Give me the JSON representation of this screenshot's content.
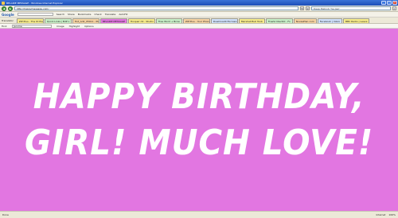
{
  "window": {
    "title": "BELAIRE MESSAGE - Windows Internet Explorer",
    "buttons": {
      "minimize": "_",
      "maximize": "□",
      "close": "×"
    }
  },
  "address_bar": {
    "url": "http://happymessage.com/",
    "search_placeholder": "Deep Mehndi \"Sa Jaa\""
  },
  "google_bar": {
    "logo": "Google",
    "items": [
      "Search",
      "Share",
      "Bookmarks",
      "Check",
      "Translate",
      "AutoFill"
    ]
  },
  "translator_bar": {
    "label": "Translator",
    "tabs": [
      {
        "label": "ZIP Plus - The ID Playing",
        "color": "#f7ec8a"
      },
      {
        "label": "Quick Links | BdP L",
        "color": "#c7f0c7"
      },
      {
        "label": "Hot_Ad2_05011 - Play",
        "color": "#f6d3a1"
      },
      {
        "label": "BELAIRE MESSAGE",
        "color": "#e276e1"
      },
      {
        "label": "Hoopeir d2 - Studio Fl",
        "color": "#f7ec8a"
      },
      {
        "label": "Free Word + Brow",
        "color": "#c7f0c7"
      },
      {
        "label": "ZIP Plus - Your Phonebo",
        "color": "#f6d3a1"
      },
      {
        "label": "Download4 Exclusive",
        "color": "#cfe1fb"
      },
      {
        "label": "Marshall Bull Toob",
        "color": "#f7ec8a"
      },
      {
        "label": "FreeScribed10 - Fo",
        "color": "#c7f0c7"
      },
      {
        "label": "NovasPlan com",
        "color": "#f6d3a1"
      },
      {
        "label": "Facebook | Inbox",
        "color": "#cfe1fb"
      },
      {
        "label": "BBC Radio | Leave",
        "color": "#f7ec8a"
      }
    ]
  },
  "command_bar": {
    "find_label": "Find:",
    "find_value": "Jerome",
    "items": [
      "Image",
      "Highlight",
      "Options"
    ]
  },
  "message": {
    "line1": "HAPPY BIRTHDAY,",
    "line2": "GIRL! MUCH LOVE!"
  },
  "status_bar": {
    "left": "Done",
    "zone": "Internet",
    "zoom": "100%"
  },
  "colors": {
    "page_background": "#e276e1",
    "message_text": "#ffffff"
  }
}
